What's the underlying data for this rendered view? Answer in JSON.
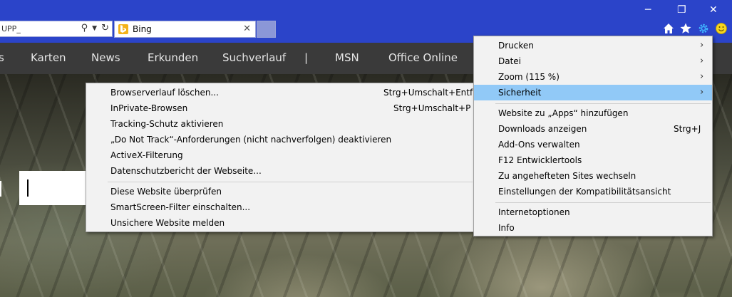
{
  "browser": {
    "address_text": "UPP_",
    "tab_title": "Bing"
  },
  "nav": {
    "items": [
      "s",
      "Karten",
      "News",
      "Erkunden",
      "Suchverlauf",
      "|",
      "MSN",
      "Office Online"
    ]
  },
  "tools_menu": {
    "items": [
      {
        "label": "Drucken",
        "shortcut": "",
        "submenu": true
      },
      {
        "label": "Datei",
        "shortcut": "",
        "submenu": true
      },
      {
        "label": "Zoom (115 %)",
        "shortcut": "",
        "submenu": true
      },
      {
        "label": "Sicherheit",
        "shortcut": "",
        "submenu": true,
        "highlighted": true
      },
      {
        "label": "Website zu „Apps“ hinzufügen",
        "shortcut": ""
      },
      {
        "label": "Downloads anzeigen",
        "shortcut": "Strg+J"
      },
      {
        "label": "Add-Ons verwalten",
        "shortcut": ""
      },
      {
        "label": "F12 Entwicklertools",
        "shortcut": ""
      },
      {
        "label": "Zu angehefteten Sites wechseln",
        "shortcut": ""
      },
      {
        "label": "Einstellungen der Kompatibilitätsansicht",
        "shortcut": ""
      },
      {
        "label": "Internetoptionen",
        "shortcut": ""
      },
      {
        "label": "Info",
        "shortcut": ""
      }
    ]
  },
  "security_menu": {
    "items": [
      {
        "label": "Browserverlauf löschen...",
        "shortcut": "Strg+Umschalt+Entf"
      },
      {
        "label": "InPrivate-Browsen",
        "shortcut": "Strg+Umschalt+P"
      },
      {
        "label": "Tracking-Schutz aktivieren",
        "shortcut": ""
      },
      {
        "label": "„Do Not Track“-Anforderungen (nicht nachverfolgen) deaktivieren",
        "shortcut": ""
      },
      {
        "label": "ActiveX-Filterung",
        "shortcut": ""
      },
      {
        "label": "Datenschutzbericht der Webseite...",
        "shortcut": ""
      },
      {
        "label": "Diese Website überprüfen",
        "shortcut": ""
      },
      {
        "label": "SmartScreen-Filter einschalten...",
        "shortcut": ""
      },
      {
        "label": "Unsichere Website melden",
        "shortcut": ""
      }
    ]
  },
  "colors": {
    "titlebar": "#2b44c9",
    "menu_highlight": "#91c9f7",
    "menu_bg": "#f2f2f2"
  }
}
